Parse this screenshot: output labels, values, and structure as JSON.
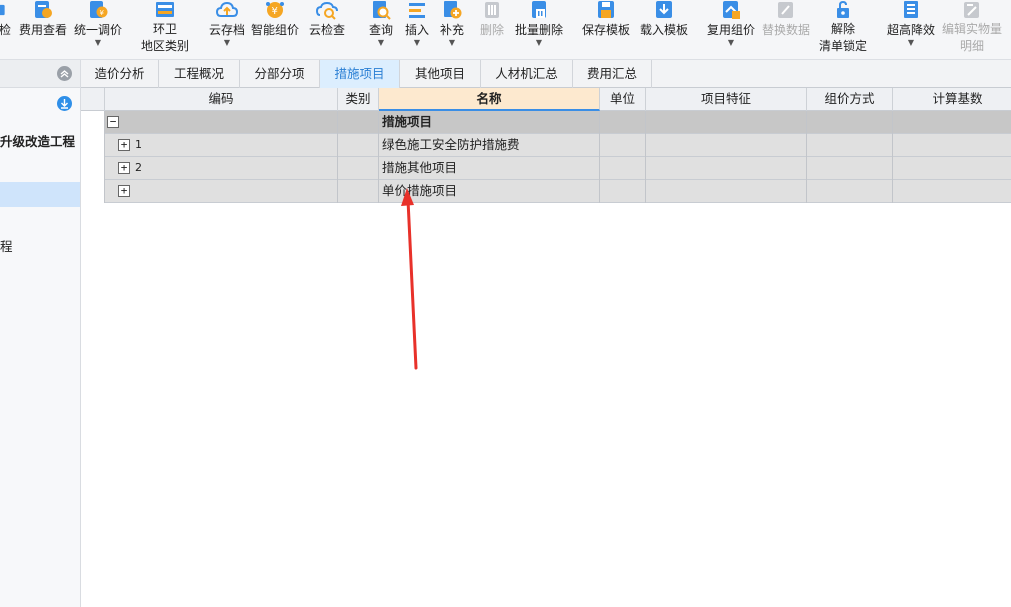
{
  "toolbar": {
    "buttons": [
      {
        "label": "检",
        "icon": "check-icon"
      },
      {
        "label": "费用查看",
        "icon": "fee-view-icon"
      },
      {
        "label": "统一调价",
        "icon": "unify-price-icon"
      },
      {
        "label": "环卫",
        "label2": "地区类别",
        "icon": "sanitation-region-icon"
      },
      {
        "label": "云存档",
        "icon": "cloud-archive-icon"
      },
      {
        "label": "智能组价",
        "icon": "smart-pricing-icon"
      },
      {
        "label": "云检查",
        "icon": "cloud-check-icon"
      },
      {
        "label": "查询",
        "icon": "query-icon"
      },
      {
        "label": "插入",
        "icon": "insert-icon"
      },
      {
        "label": "补充",
        "icon": "supplement-icon"
      },
      {
        "label": "删除",
        "icon": "delete-icon"
      },
      {
        "label": "批量删除",
        "icon": "batch-delete-icon"
      },
      {
        "label": "保存模板",
        "icon": "save-template-icon"
      },
      {
        "label": "载入模板",
        "icon": "load-template-icon"
      },
      {
        "label": "复用组价",
        "icon": "reuse-pricing-icon"
      },
      {
        "label": "替换数据",
        "icon": "replace-data-icon"
      },
      {
        "label": "解除",
        "label2": "清单锁定",
        "icon": "unlock-list-icon"
      },
      {
        "label": "超高降效",
        "icon": "high-efficiency-icon"
      },
      {
        "label": "编辑实物量",
        "label2": "明细",
        "icon": "edit-quantity-icon"
      }
    ]
  },
  "left_panel": {
    "items": [
      {
        "label": "升级改造工程"
      },
      {
        "label": "程"
      }
    ]
  },
  "tabs": [
    {
      "label": "造价分析"
    },
    {
      "label": "工程概况"
    },
    {
      "label": "分部分项"
    },
    {
      "label": "措施项目",
      "active": true
    },
    {
      "label": "其他项目"
    },
    {
      "label": "人材机汇总"
    },
    {
      "label": "费用汇总"
    }
  ],
  "table": {
    "columns": [
      "编码",
      "类别",
      "名称",
      "单位",
      "项目特征",
      "组价方式",
      "计算基数"
    ],
    "rows": [
      {
        "expander": "−",
        "code": "",
        "name": "措施项目"
      },
      {
        "expander": "+",
        "code": "1",
        "name": "绿色施工安全防护措施费"
      },
      {
        "expander": "+",
        "code": "2",
        "name": "措施其他项目"
      },
      {
        "expander": "+",
        "code": "",
        "name": "单价措施项目"
      }
    ]
  },
  "colors": {
    "active_tab_text": "#2a7fd4",
    "active_tab_bg": "#dceefe",
    "header_highlight": "#fde9cf",
    "row_selected_bg": "#cfe4fb",
    "annotation_arrow": "#e8312a"
  }
}
